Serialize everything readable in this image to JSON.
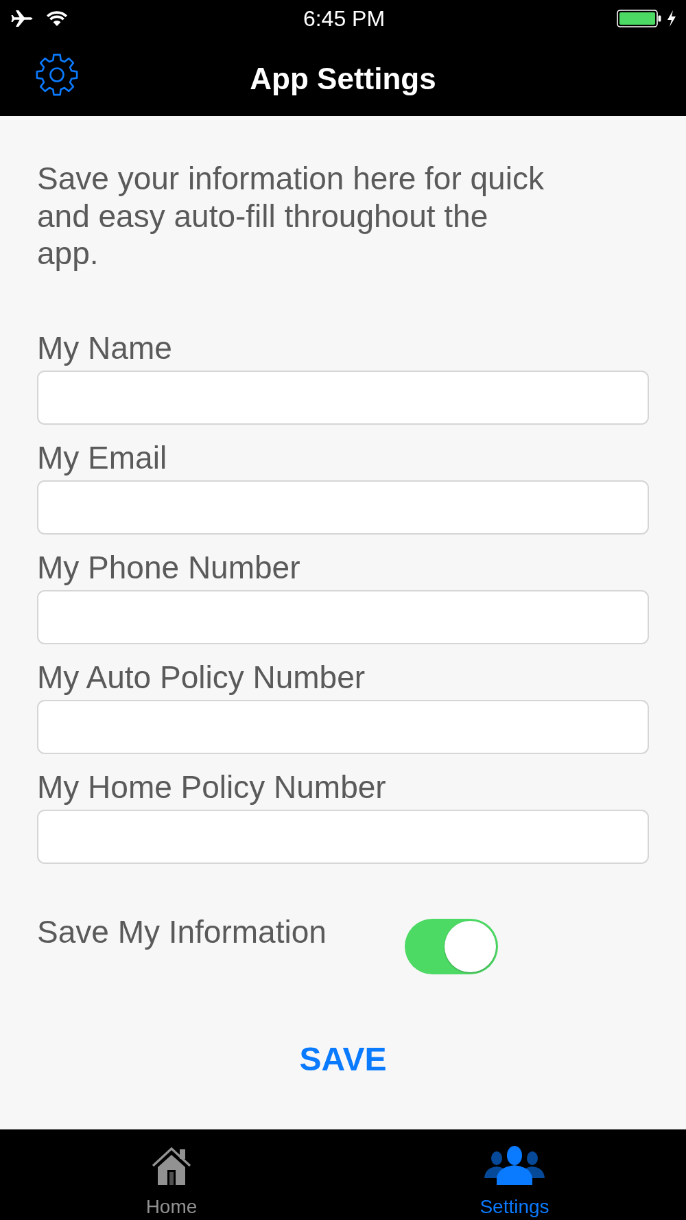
{
  "status_bar": {
    "time": "6:45 PM"
  },
  "nav_bar": {
    "title": "App Settings"
  },
  "intro": "Save your information here for quick and easy auto-fill throughout the app.",
  "fields": [
    {
      "label": "My Name"
    },
    {
      "label": "My Email"
    },
    {
      "label": "My Phone Number"
    },
    {
      "label": "My Auto Policy Number"
    },
    {
      "label": "My Home Policy Number"
    }
  ],
  "toggle": {
    "label": "Save My Information",
    "on": true
  },
  "save_button": {
    "label": "SAVE"
  },
  "tab_bar": {
    "tabs": [
      {
        "label": "Home",
        "selected": false
      },
      {
        "label": "Settings",
        "selected": true
      }
    ]
  }
}
